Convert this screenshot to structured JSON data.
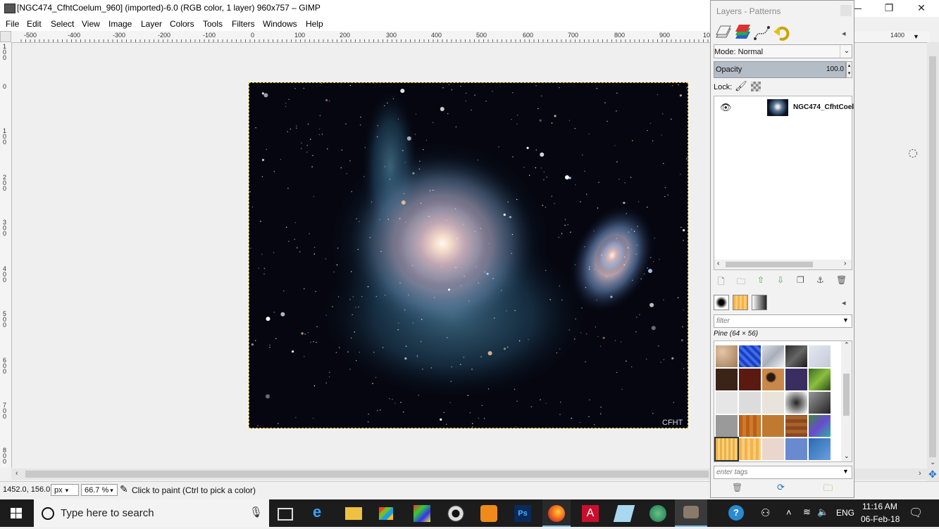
{
  "window": {
    "title": "[NGC474_CfhtCoelum_960] (imported)-6.0 (RGB color, 1 layer) 960x757 – GIMP",
    "controls": {
      "minimize": "—",
      "restore": "❐",
      "close": "✕"
    }
  },
  "menu": [
    "File",
    "Edit",
    "Select",
    "View",
    "Image",
    "Layer",
    "Colors",
    "Tools",
    "Filters",
    "Windows",
    "Help"
  ],
  "ruler": {
    "h_labels": [
      "-500",
      "-400",
      "-300",
      "-200",
      "-100",
      "0",
      "100",
      "200",
      "300",
      "400",
      "500",
      "600",
      "700",
      "800",
      "900",
      "1000",
      "1400"
    ],
    "v_labels": [
      "1 0 0",
      "0",
      "1 0 0",
      "2 0 0",
      "3 0 0",
      "4 0 0",
      "5 0 0",
      "6 0 0",
      "7 0 0",
      "8 0 0"
    ]
  },
  "image": {
    "watermark": "CFHT"
  },
  "status": {
    "coords": "1452.0, 156.0",
    "unit": "px",
    "zoom": "66.7 %",
    "message": "Click to paint (Ctrl to pick a color)"
  },
  "dock": {
    "title": "Layers - Patterns",
    "mode_label": "Mode: Normal",
    "opacity_label": "Opacity",
    "opacity_value": "100.0",
    "lock_label": "Lock:",
    "layer_name": "NGC474_CfhtCoel",
    "filter_placeholder": "filter",
    "pattern_name": "Pine (64 × 56)",
    "tags_placeholder": "enter tags"
  },
  "taskbar": {
    "search_placeholder": "Type here to search",
    "lang": "ENG",
    "time": "11:16 AM",
    "date": "06-Feb-18"
  },
  "colors": {
    "accent": "#0078d7",
    "guide": "#e6c400",
    "taskbar": "#1c1c1c"
  }
}
